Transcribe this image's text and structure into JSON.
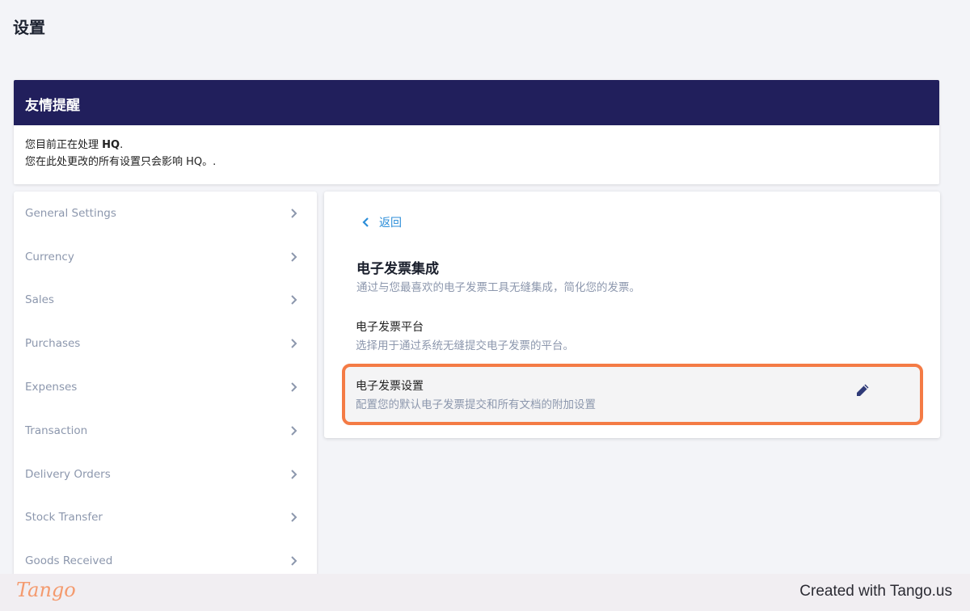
{
  "page": {
    "title": "设置"
  },
  "notice": {
    "heading": "友情提醒",
    "line1_prefix": "您目前正在处理 ",
    "line1_entity": "HQ",
    "line1_suffix": ".",
    "line2": "您在此处更改的所有设置只会影响 HQ。."
  },
  "sidebar": {
    "items": [
      {
        "label": "General Settings"
      },
      {
        "label": "Currency"
      },
      {
        "label": "Sales"
      },
      {
        "label": "Purchases"
      },
      {
        "label": "Expenses"
      },
      {
        "label": "Transaction"
      },
      {
        "label": "Delivery Orders"
      },
      {
        "label": "Stock Transfer"
      },
      {
        "label": "Goods Received"
      }
    ]
  },
  "panel": {
    "back_label": "返回",
    "title": "电子发票集成",
    "description": "通过与您最喜欢的电子发票工具无缝集成，简化您的发票。",
    "rows": [
      {
        "title": "电子发票平台",
        "description": "选择用于通过系统无缝提交电子发票的平台。"
      },
      {
        "title": "电子发票设置",
        "description": "配置您的默认电子发票提交和所有文档的附加设置"
      }
    ]
  },
  "footer": {
    "logo_text": "Tango",
    "credit": "Created with Tango.us"
  },
  "colors": {
    "notice_header": "#211f5c",
    "link": "#2c8ed9",
    "highlight_border": "#f47b45",
    "muted_text": "#8c97ad",
    "edit_icon": "#2f3a78"
  }
}
